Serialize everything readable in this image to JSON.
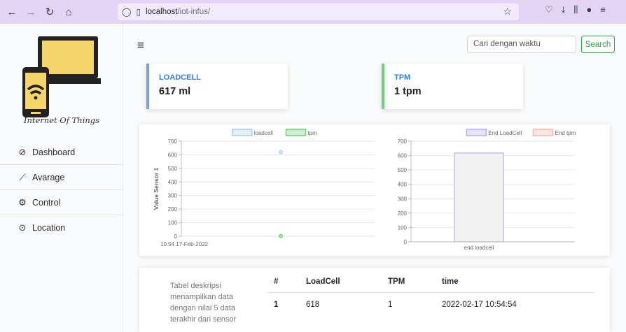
{
  "browser": {
    "url_host": "localhost",
    "url_path": "/iot-infus/",
    "nav_icons": [
      "back-icon",
      "forward-icon",
      "reload-icon",
      "home-icon"
    ]
  },
  "sidebar": {
    "tagline": "Internet Of Things",
    "items": [
      {
        "label": "Dashboard",
        "icon": "dashboard-icon",
        "glyph": "⊘"
      },
      {
        "label": "Avarage",
        "icon": "chart-line-icon",
        "glyph": "⟋"
      },
      {
        "label": "Control",
        "icon": "gears-icon",
        "glyph": "⚙"
      },
      {
        "label": "Location",
        "icon": "location-pin-icon",
        "glyph": "⊙"
      }
    ]
  },
  "topbar": {
    "search_placeholder": "Cari dengan waktu",
    "search_button": "Search"
  },
  "cards": {
    "loadcell": {
      "label": "LOADCELL",
      "value": "617 ml",
      "color": "#7b9ee0"
    },
    "tpm": {
      "label": "TPM",
      "value": "1 tpm",
      "color": "#6fcf7a"
    }
  },
  "chart_data": [
    {
      "type": "scatter",
      "x": [
        "10:54 17-Feb-2022"
      ],
      "series": [
        {
          "name": "loadcell",
          "values": [
            618
          ],
          "color": "#a8d0e6"
        },
        {
          "name": "tpm",
          "values": [
            1
          ],
          "color": "#6fcf7a"
        }
      ],
      "ylabel": "Value Sensor 1",
      "ylim": [
        0,
        700
      ],
      "yticks": [
        "700",
        "600",
        "500",
        "400",
        "300",
        "200",
        "100",
        "0"
      ],
      "legend": "top"
    },
    {
      "type": "bar",
      "categories": [
        "end loadcell"
      ],
      "series": [
        {
          "name": "End LoadCell",
          "values": [
            618
          ],
          "color": "#b8b0ec"
        },
        {
          "name": "End tpm",
          "values": [
            1
          ],
          "color": "#f5b8a8"
        }
      ],
      "ylim": [
        0,
        700
      ],
      "yticks": [
        "700",
        "600",
        "500",
        "400",
        "300",
        "200",
        "100",
        "0"
      ],
      "legend": "top"
    }
  ],
  "table": {
    "description": "Tabel deskripsi menampilkan data dengan nilai 5 data terakhir dari sensor",
    "headers": [
      "#",
      "LoadCell",
      "TPM",
      "time"
    ],
    "rows": [
      [
        "1",
        "618",
        "1",
        "2022-02-17 10:54:54"
      ]
    ]
  }
}
